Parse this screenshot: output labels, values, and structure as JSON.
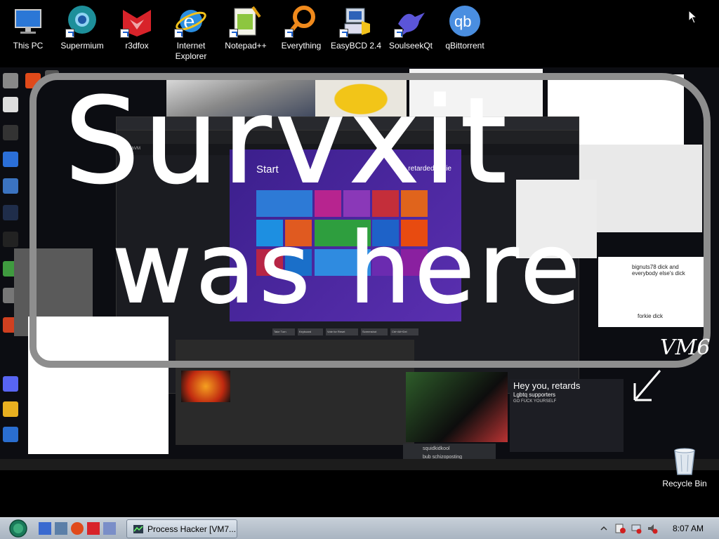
{
  "desktop": {
    "icons": [
      {
        "label": "This PC",
        "icon": "monitor-icon"
      },
      {
        "label": "Supermium",
        "icon": "supermium-icon"
      },
      {
        "label": "r3dfox",
        "icon": "r3dfox-icon"
      },
      {
        "label": "Internet",
        "label2": "Explorer",
        "icon": "ie-icon"
      },
      {
        "label": "Notepad++",
        "icon": "notepadpp-icon"
      },
      {
        "label": "Everything",
        "icon": "everything-icon"
      },
      {
        "label": "EasyBCD 2.4",
        "icon": "easybcd-icon"
      },
      {
        "label": "SoulseekQt",
        "icon": "soulseek-icon"
      },
      {
        "label": "qBittorrent",
        "icon": "qbittorrent-icon"
      }
    ],
    "recycle_bin": "Recycle Bin"
  },
  "inner_screen": {
    "scribble_line1": "Survxit",
    "scribble_line2": "was here",
    "scribble_tag": "VM6",
    "metro_start": "Start",
    "metro_user": "retardedforkie",
    "browser_nav": "CollabVM",
    "note_text": "bignuts78 dick and everybody else's dick",
    "note_text2": "forkie dick",
    "hey_title": "Hey you, retards",
    "hey_sub": "Lgbtq supporters",
    "hey_line": "GO FUCK YOURSELF",
    "chat_name": "squidkidkool",
    "chat_msg": "bub schizoposting",
    "vm_buttons": [
      "Take Turn",
      "Keyboard",
      "Vote for Reset",
      "Screenshot",
      "Ctrl+Alt+Del"
    ]
  },
  "taskbar": {
    "active_window": "Process Hacker [VM7...",
    "clock": "8:07 AM"
  },
  "colors": {
    "taskbar": "#b9c3cf",
    "metro_bg": "#4a27a0",
    "frame_gray": "#8e8e8e"
  }
}
